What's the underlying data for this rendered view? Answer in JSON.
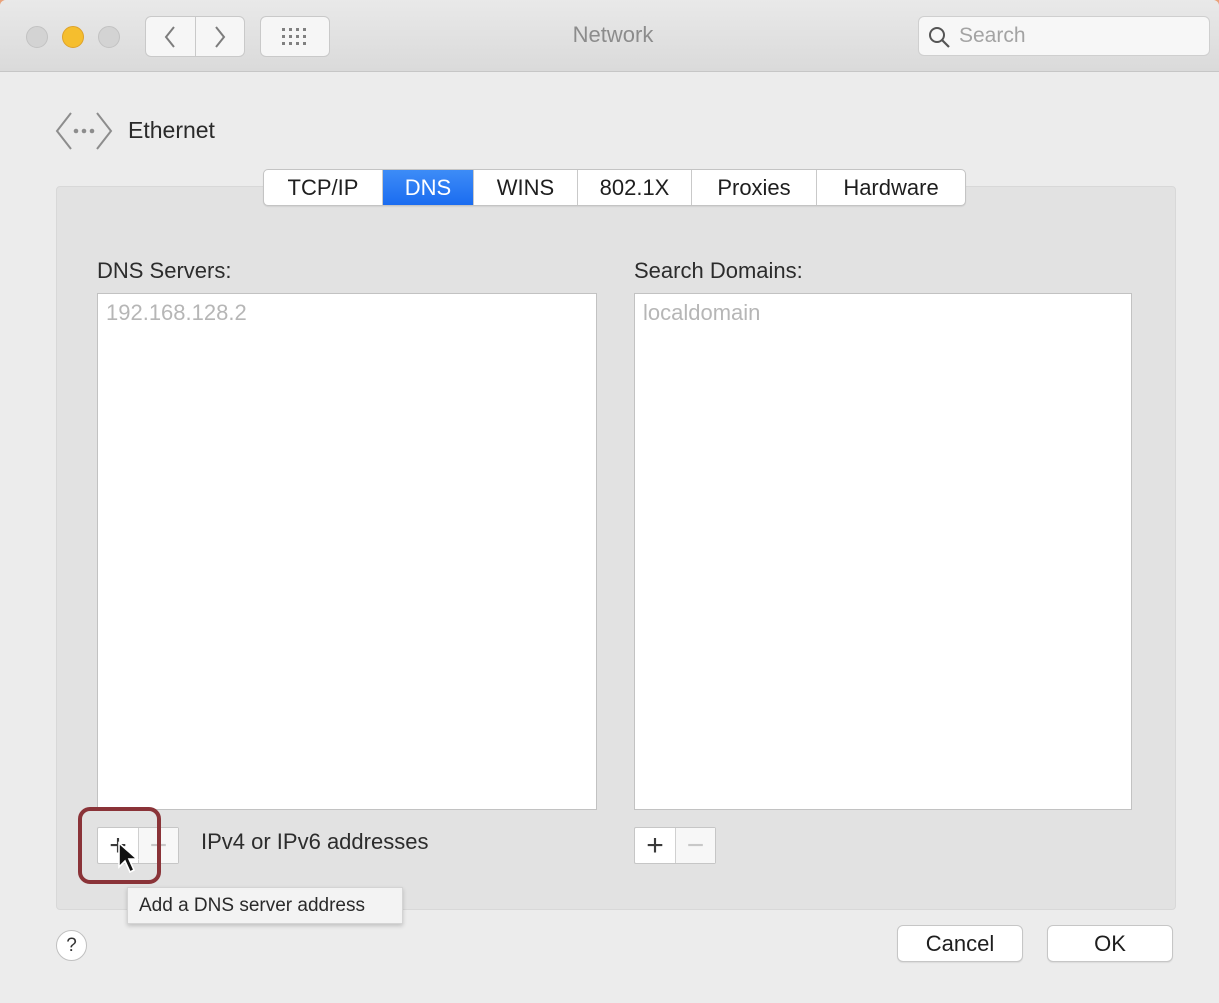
{
  "window": {
    "title": "Network",
    "search_placeholder": "Search"
  },
  "header": {
    "interface_name": "Ethernet"
  },
  "tabs": [
    {
      "label": "TCP/IP",
      "active": false
    },
    {
      "label": "DNS",
      "active": true
    },
    {
      "label": "WINS",
      "active": false
    },
    {
      "label": "802.1X",
      "active": false
    },
    {
      "label": "Proxies",
      "active": false
    },
    {
      "label": "Hardware",
      "active": false
    }
  ],
  "dns_servers": {
    "label": "DNS Servers:",
    "items": [
      "192.168.128.2"
    ],
    "hint": "IPv4 or IPv6 addresses",
    "add_label": "+",
    "remove_label": "−"
  },
  "search_domains": {
    "label": "Search Domains:",
    "items": [
      "localdomain"
    ],
    "add_label": "+",
    "remove_label": "−"
  },
  "tooltip": {
    "text": "Add a DNS server address"
  },
  "footer": {
    "help_label": "?",
    "cancel_label": "Cancel",
    "ok_label": "OK"
  },
  "colors": {
    "accent": "#1b6cf0",
    "highlight_ring": "#8a3338",
    "minimize_button": "#f5be2e"
  },
  "icons": [
    "chevron-left-icon",
    "chevron-right-icon",
    "grid-icon",
    "search-icon",
    "ethernet-icon",
    "pointer-cursor-icon"
  ]
}
